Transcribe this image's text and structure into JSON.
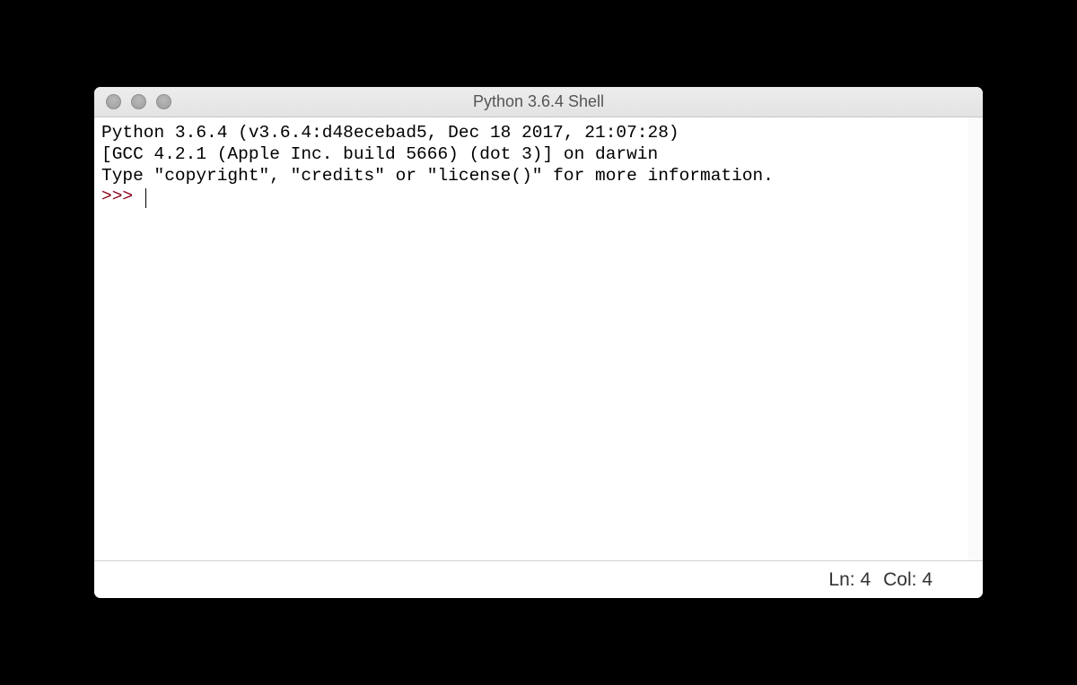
{
  "window": {
    "title": "Python 3.6.4 Shell"
  },
  "shell": {
    "line1": "Python 3.6.4 (v3.6.4:d48ecebad5, Dec 18 2017, 21:07:28) ",
    "line2": "[GCC 4.2.1 (Apple Inc. build 5666) (dot 3)] on darwin",
    "line3": "Type \"copyright\", \"credits\" or \"license()\" for more information.",
    "prompt": ">>> "
  },
  "status": {
    "line_label": "Ln: 4",
    "col_label": "Col: 4"
  }
}
